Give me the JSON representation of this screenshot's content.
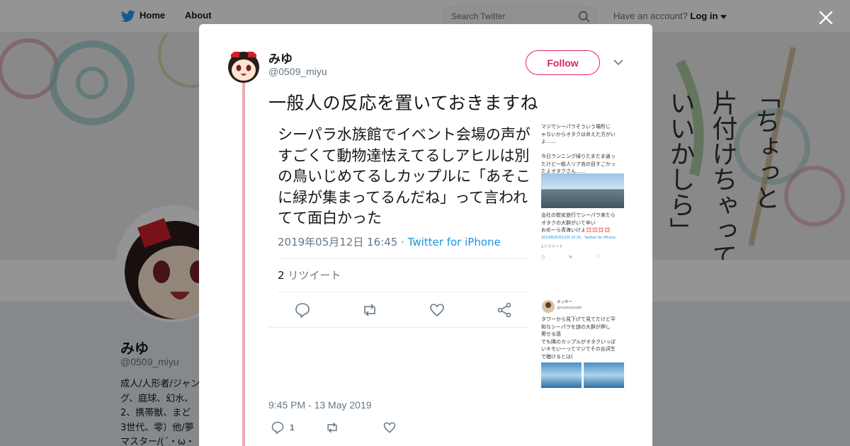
{
  "topbar": {
    "home_label": "Home",
    "about_label": "About",
    "search_placeholder": "Search Twitter",
    "account_prompt": "Have an account?",
    "login_label": "Log in"
  },
  "profile": {
    "name": "みゆ",
    "handle": "@0509_miyu",
    "bio": "成人/人形者/ジャン\nグ、庭球、幻水、\n2、携帯獣、まど\n3世代、零）他/夢\nマスター/(´・ω・"
  },
  "tweet": {
    "display_name": "みゆ",
    "handle": "@0509_miyu",
    "follow_label": "Follow",
    "text": "一般人の反応を置いておきますね",
    "timestamp": "9:45 PM - 13 May 2019",
    "reply_count": "1"
  },
  "screenshot": {
    "main_text": "シーパラ水族館でイベント会場の声がすごくて動物達怯えてるしアヒルは別の鳥いじめてるしカップルに「あそこに緑が集まってるんだね」って言われてて面白かった",
    "date": "2019年05月12日 16:45",
    "via": "Twitter for iPhone",
    "retweet_count": "2",
    "retweet_label": "リツイート",
    "side_text_1": "マジでシーパラそういう場所じ\nゃないからオタクは弁えた方がい\nよ……\n\n今日ランニング帰りたまたま通っ\nたけど一般人リア充の目すごかっ\nたよオタクさん……",
    "side_text_2": "会社の慰安旅行でシーパラ来たら\nオタクの大群がいて辛い\nおめーら青海いけよ💢💢💢💢",
    "side_date": "2019年05月12日 10:31 · Twitter for iPhone",
    "side_rt": "1リツイート",
    "side_user": "ヌッキー",
    "side_handle": "@nukkytanaki",
    "side_text_3": "タワーから見下げて見てたけど平\n和なシーパラを謎の大群が押し\n寄せる感\nでも隣のカップルがオタクいっぱ\nいキモいーってマジでその台詞生\nで聴けるとは("
  },
  "colors": {
    "accent": "#e0245e",
    "link": "#1b95e0",
    "thread": "#f0a8b6",
    "twitter_blue": "#1da1f2"
  }
}
